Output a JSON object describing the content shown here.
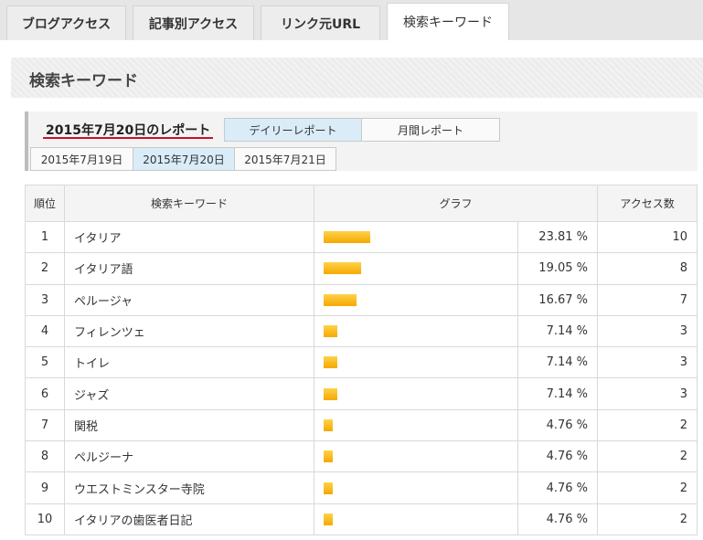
{
  "tabs": [
    {
      "label": "ブログアクセス",
      "active": false
    },
    {
      "label": "記事別アクセス",
      "active": false
    },
    {
      "label": "リンク元URL",
      "active": false
    },
    {
      "label": "検索キーワード",
      "active": true
    }
  ],
  "section": {
    "title": "検索キーワード"
  },
  "report": {
    "title": "2015年7月20日のレポート",
    "modes": [
      {
        "label": "デイリーレポート",
        "selected": true
      },
      {
        "label": "月間レポート",
        "selected": false
      }
    ],
    "dates": [
      {
        "label": "2015年7月19日",
        "selected": false
      },
      {
        "label": "2015年7月20日",
        "selected": true
      },
      {
        "label": "2015年7月21日",
        "selected": false
      }
    ]
  },
  "table": {
    "headers": {
      "rank": "順位",
      "keyword": "検索キーワード",
      "graph": "グラフ",
      "count": "アクセス数"
    },
    "rows": [
      {
        "rank": "1",
        "keyword": "イタリア",
        "percent_text": "23.81 %",
        "share": 23.81,
        "count": "10"
      },
      {
        "rank": "2",
        "keyword": "イタリア語",
        "percent_text": "19.05 %",
        "share": 19.05,
        "count": "8"
      },
      {
        "rank": "3",
        "keyword": "ペルージャ",
        "percent_text": "16.67 %",
        "share": 16.67,
        "count": "7"
      },
      {
        "rank": "4",
        "keyword": "フィレンツェ",
        "percent_text": "7.14 %",
        "share": 7.14,
        "count": "3"
      },
      {
        "rank": "5",
        "keyword": "トイレ",
        "percent_text": "7.14 %",
        "share": 7.14,
        "count": "3"
      },
      {
        "rank": "6",
        "keyword": "ジャズ",
        "percent_text": "7.14 %",
        "share": 7.14,
        "count": "3"
      },
      {
        "rank": "7",
        "keyword": "関税",
        "percent_text": "4.76 %",
        "share": 4.76,
        "count": "2"
      },
      {
        "rank": "8",
        "keyword": "ペルジーナ",
        "percent_text": "4.76 %",
        "share": 4.76,
        "count": "2"
      },
      {
        "rank": "9",
        "keyword": "ウエストミンスター寺院",
        "percent_text": "4.76 %",
        "share": 4.76,
        "count": "2"
      },
      {
        "rank": "10",
        "keyword": "イタリアの歯医者日記",
        "percent_text": "4.76 %",
        "share": 4.76,
        "count": "2"
      }
    ]
  },
  "colors": {
    "bar": "#f5b400",
    "selected_button": "#d9ecf7",
    "underline": "#c8102e"
  }
}
